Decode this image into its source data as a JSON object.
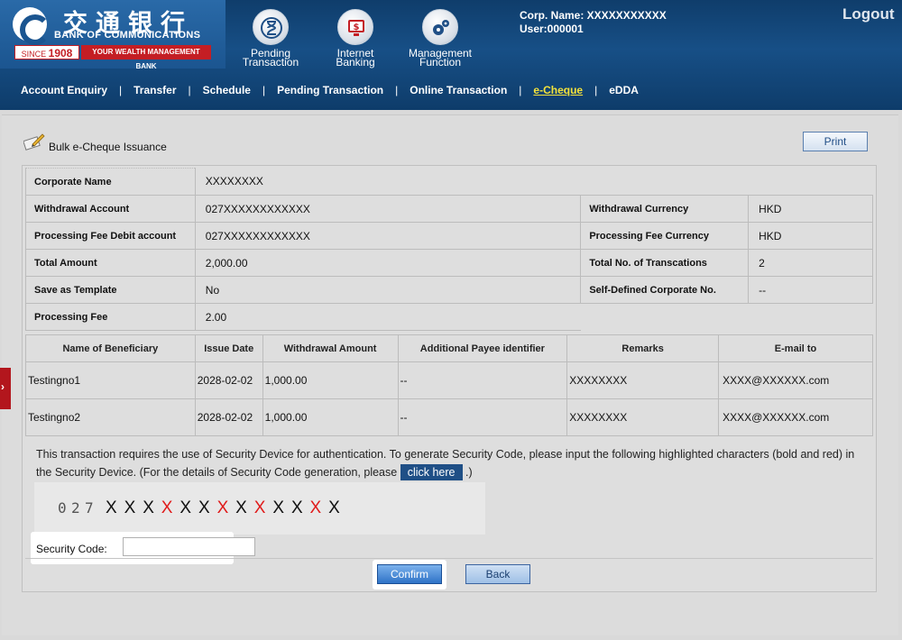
{
  "header": {
    "logo_cn": "交通银行",
    "logo_en": "BANK OF COMMUNICATIONS",
    "logo_since_prefix": "SINCE",
    "logo_since_year": "1908",
    "logo_tagline": "YOUR WEALTH MANAGEMENT BANK",
    "top_nav": [
      {
        "line1": "Pending",
        "line2": "Transaction",
        "icon": "hourglass-icon"
      },
      {
        "line1": "Internet",
        "line2": "Banking",
        "icon": "monitor-dollar-icon"
      },
      {
        "line1": "Management",
        "line2": "Function",
        "icon": "gears-icon"
      }
    ],
    "corp_name": "Corp. Name: XXXXXXXXXXX",
    "user": "User:000001",
    "logout": "Logout"
  },
  "main_nav": [
    {
      "label": "Account Enquiry"
    },
    {
      "label": "Transfer"
    },
    {
      "label": "Schedule"
    },
    {
      "label": "Pending Transaction"
    },
    {
      "label": "Online Transaction"
    },
    {
      "label": "e-Cheque",
      "active": true
    },
    {
      "label": "eDDA"
    }
  ],
  "page": {
    "title": "Bulk e-Cheque Issuance",
    "print_label": "Print"
  },
  "info": {
    "corporate_name_label": "Corporate Name",
    "corporate_name": "XXXXXXXX",
    "withdrawal_account_label": "Withdrawal Account",
    "withdrawal_account": "027XXXXXXXXXXXX",
    "withdrawal_currency_label": "Withdrawal Currency",
    "withdrawal_currency": "HKD",
    "fee_debit_account_label": "Processing Fee Debit account",
    "fee_debit_account": "027XXXXXXXXXXXX",
    "fee_currency_label": "Processing Fee Currency",
    "fee_currency": "HKD",
    "total_amount_label": "Total Amount",
    "total_amount": "2,000.00",
    "total_no_label": "Total No. of Transcations",
    "total_no": "2",
    "save_template_label": "Save as Template",
    "save_template": "No",
    "self_defined_label": "Self-Defined Corporate No.",
    "self_defined": "--",
    "processing_fee_label": "Processing Fee",
    "processing_fee": "2.00"
  },
  "beneficiaries": {
    "headers": [
      "Name of Beneficiary",
      "Issue Date",
      "Withdrawal Amount",
      "Additional Payee identifier",
      "Remarks",
      "E-mail to"
    ],
    "rows": [
      [
        "Testingno1",
        "2028-02-02",
        "1,000.00",
        "--",
        "XXXXXXXX",
        "XXXX@XXXXXX.com"
      ],
      [
        "Testingno2",
        "2028-02-02",
        "1,000.00",
        "--",
        "XXXXXXXX",
        "XXXX@XXXXXX.com"
      ]
    ]
  },
  "security": {
    "notice": "This transaction requires the use of Security Device for authentication. To generate Security Code, please input the following highlighted characters (bold and red) in the Security Device. (For the details of Security Code generation, please",
    "click_here": "click here",
    "notice_end": ".)",
    "code_digits": [
      "0",
      "2",
      "7"
    ],
    "code_chars": [
      {
        "c": "X",
        "red": false
      },
      {
        "c": "X",
        "red": false
      },
      {
        "c": "X",
        "red": false
      },
      {
        "c": "X",
        "red": true
      },
      {
        "c": "X",
        "red": false
      },
      {
        "c": "X",
        "red": false
      },
      {
        "c": "X",
        "red": true
      },
      {
        "c": "X",
        "red": false
      },
      {
        "c": "X",
        "red": true
      },
      {
        "c": "X",
        "red": false
      },
      {
        "c": "X",
        "red": false
      },
      {
        "c": "X",
        "red": true
      },
      {
        "c": "X",
        "red": false
      }
    ],
    "code_label": "Security Code:",
    "code_value": ""
  },
  "actions": {
    "confirm": "Confirm",
    "back": "Back"
  },
  "colors": {
    "header_blue": "#174f86",
    "brand_red": "#c41e24",
    "active_nav": "#f5e23b",
    "highlight_red": "#e01b1b"
  }
}
